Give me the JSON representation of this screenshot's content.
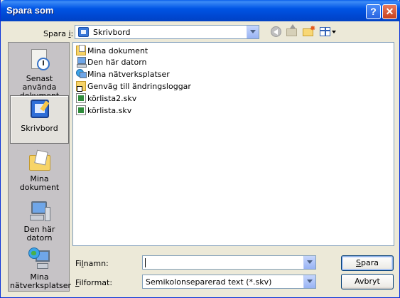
{
  "window": {
    "title": "Spara som",
    "help_label": "?",
    "close_label": "✕"
  },
  "toolbar": {
    "save_in_label_pre": "Spara ",
    "save_in_label_key": "i",
    "save_in_label_post": ":",
    "save_in_value": "Skrivbord",
    "icons": [
      "back-icon",
      "up-folder-icon",
      "new-folder-icon",
      "views-menu-icon"
    ]
  },
  "places": [
    {
      "label": "Senast använda dokument",
      "icon": "recent-documents-icon",
      "selected": false
    },
    {
      "label": "Skrivbord",
      "icon": "desktop-icon",
      "selected": true
    },
    {
      "label": "Mina dokument",
      "icon": "my-documents-icon",
      "selected": false
    },
    {
      "label": "Den här datorn",
      "icon": "my-computer-icon",
      "selected": false
    },
    {
      "label": "Mina nätverksplatser",
      "icon": "network-places-icon",
      "selected": false
    }
  ],
  "files": [
    {
      "name": "Mina dokument",
      "icon": "my-documents-icon"
    },
    {
      "name": "Den här datorn",
      "icon": "my-computer-icon"
    },
    {
      "name": "Mina nätverksplatser",
      "icon": "network-places-icon"
    },
    {
      "name": "Genväg till ändringsloggar",
      "icon": "shortcut-folder-icon"
    },
    {
      "name": "körlista2.skv",
      "icon": "skv-file-icon"
    },
    {
      "name": "körlista.skv",
      "icon": "skv-file-icon"
    }
  ],
  "filename": {
    "label_pre": "Fi",
    "label_key": "l",
    "label_post": "namn:",
    "value": ""
  },
  "filetype": {
    "label_key": "F",
    "label_post": "ilformat:",
    "value": "Semikolonseparerad text (*.skv)"
  },
  "buttons": {
    "save_key": "S",
    "save_rest": "para",
    "cancel": "Avbryt"
  }
}
